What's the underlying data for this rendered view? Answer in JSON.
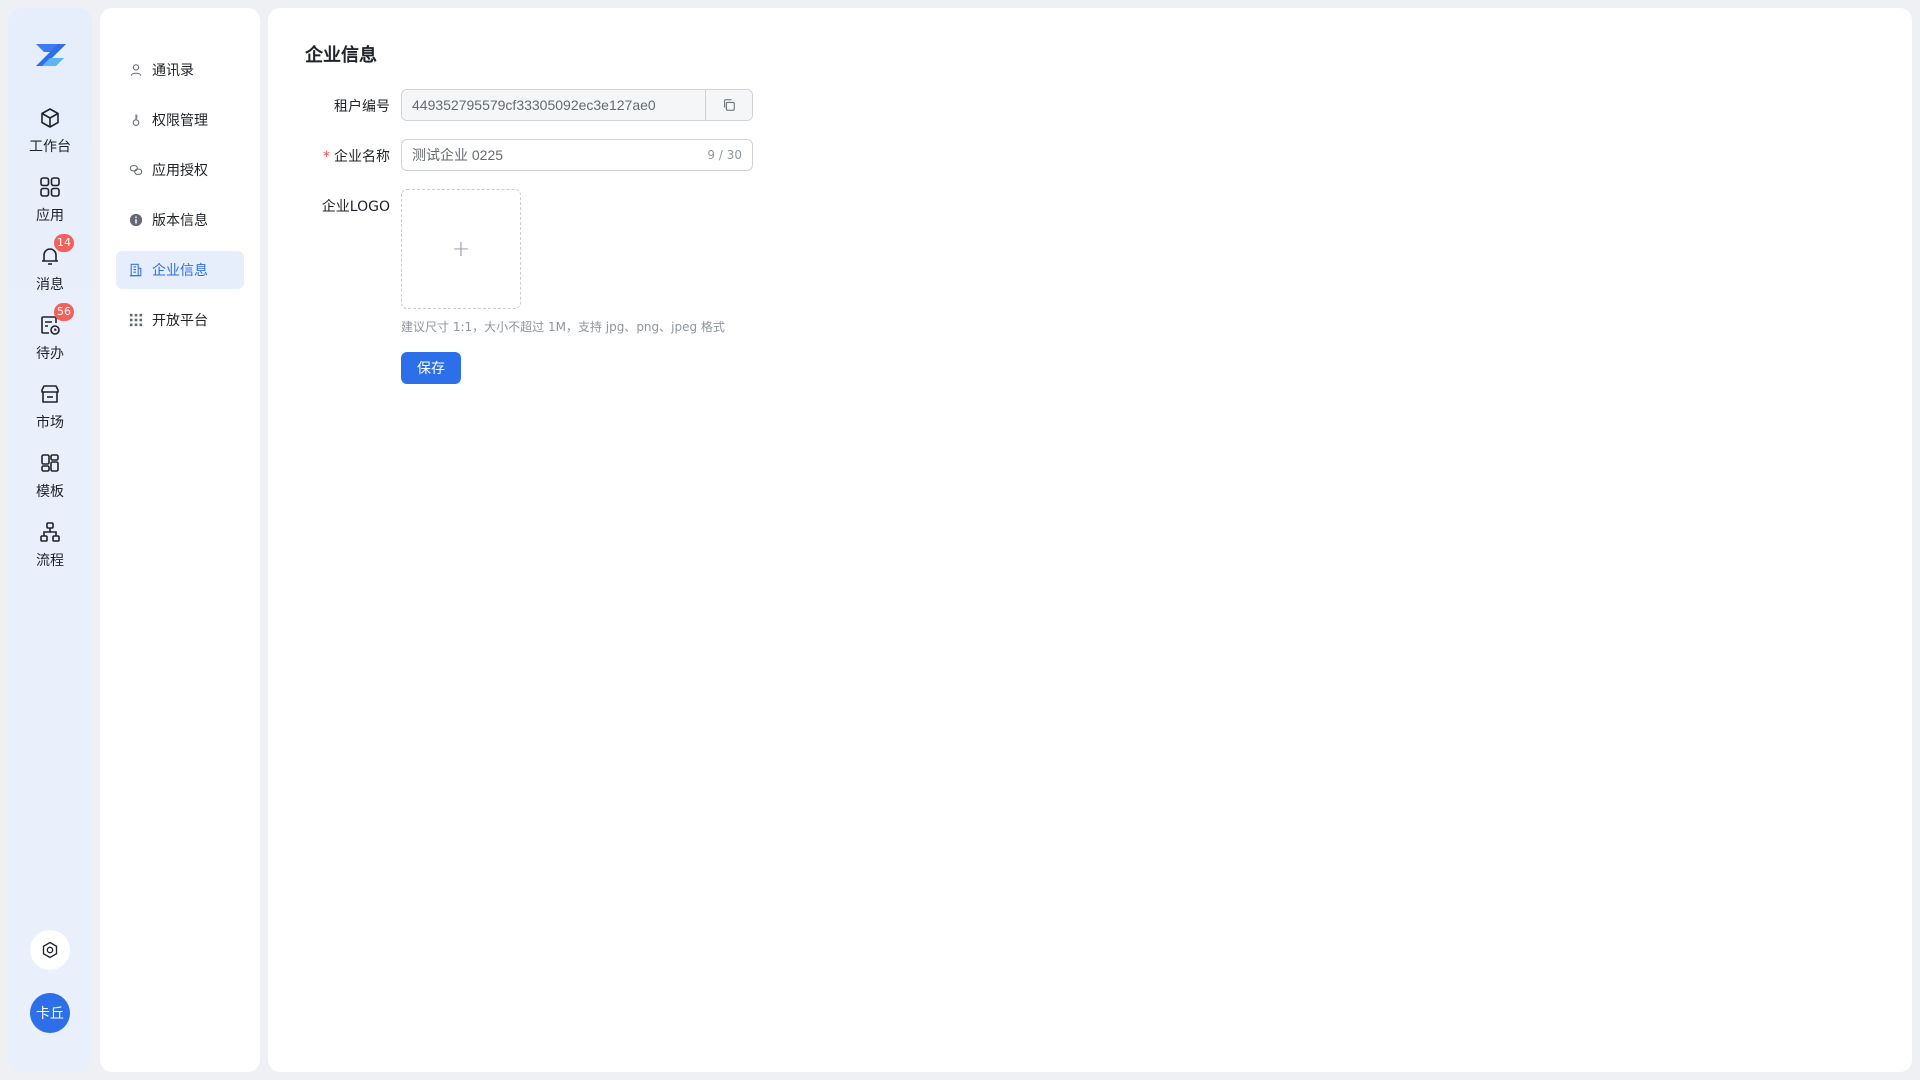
{
  "rail": {
    "items": [
      {
        "label": "工作台",
        "icon": "cube-icon"
      },
      {
        "label": "应用",
        "icon": "grid-icon"
      },
      {
        "label": "消息",
        "icon": "bell-icon",
        "badge": "14"
      },
      {
        "label": "待办",
        "icon": "todo-icon",
        "badge": "56"
      },
      {
        "label": "市场",
        "icon": "store-icon"
      },
      {
        "label": "模板",
        "icon": "template-icon"
      },
      {
        "label": "流程",
        "icon": "flow-icon"
      }
    ],
    "avatar_text": "卡丘"
  },
  "subnav": {
    "items": [
      {
        "label": "通讯录",
        "icon": "user-icon"
      },
      {
        "label": "权限管理",
        "icon": "key-icon"
      },
      {
        "label": "应用授权",
        "icon": "link-icon"
      },
      {
        "label": "版本信息",
        "icon": "info-icon"
      },
      {
        "label": "企业信息",
        "icon": "building-icon",
        "active": true
      },
      {
        "label": "开放平台",
        "icon": "dots-grid-icon"
      }
    ]
  },
  "main": {
    "title": "企业信息",
    "tenant": {
      "label": "租户编号",
      "value": "449352795579cf33305092ec3e127ae0"
    },
    "company_name": {
      "required_mark": "*",
      "label": "企业名称",
      "value": "测试企业 0225",
      "counter": "9 / 30"
    },
    "logo": {
      "label": "企业LOGO",
      "upload_symbol": "+",
      "hint": "建议尺寸 1:1，大小不超过 1M，支持 jpg、png、jpeg 格式"
    },
    "save_label": "保存"
  },
  "colors": {
    "accent": "#2d6fe8",
    "badge": "#f5605d",
    "active_bg": "#e6eefc"
  }
}
